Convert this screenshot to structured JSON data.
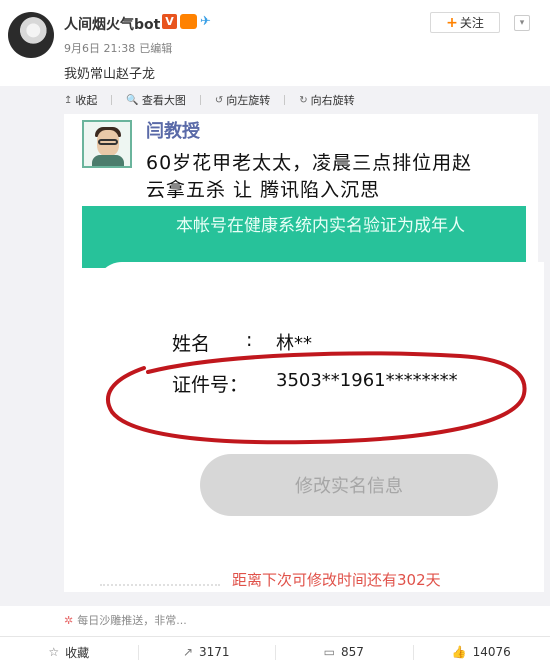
{
  "post": {
    "author": "人间烟火气bot",
    "badge_v": "V",
    "time": "9月6日 21:38",
    "edited": "已编辑",
    "text": "我奶常山赵子龙",
    "follow_label": "关注",
    "follow_plus": "+",
    "menu_arrow": "▾"
  },
  "image_tools": [
    {
      "icon": "↥",
      "label": "收起"
    },
    {
      "icon": "🔍",
      "label": "查看大图"
    },
    {
      "icon": "↺",
      "label": "向左旋转"
    },
    {
      "icon": "↻",
      "label": "向右旋转"
    }
  ],
  "image": {
    "prof_name": "闫教授",
    "headline_line1": "60岁花甲老太太，凌晨三点排位用赵",
    "headline_line2": "云拿五杀 让 腾讯陷入沉思",
    "green_text": "本帐号在健康系统内实名验证为成年人",
    "name_label": "姓名",
    "colon": ":",
    "name_value": "林**",
    "id_label": "证件号：",
    "id_value": "3503**1961********",
    "modify_button": "修改实名信息",
    "countdown": "距离下次可修改时间还有302天"
  },
  "push": {
    "icon": "✲",
    "text": "每日沙雕推送，非常..."
  },
  "actions": [
    {
      "icon": "☆",
      "label": "收藏"
    },
    {
      "icon": "↗",
      "label": "3171"
    },
    {
      "icon": "▭",
      "label": "857"
    },
    {
      "icon": "👍",
      "label": "14076"
    }
  ],
  "colors": {
    "accent_orange": "#ff8200",
    "green_band": "#27c29a",
    "red_annotation": "#c0171d",
    "countdown_red": "#e0524a"
  }
}
